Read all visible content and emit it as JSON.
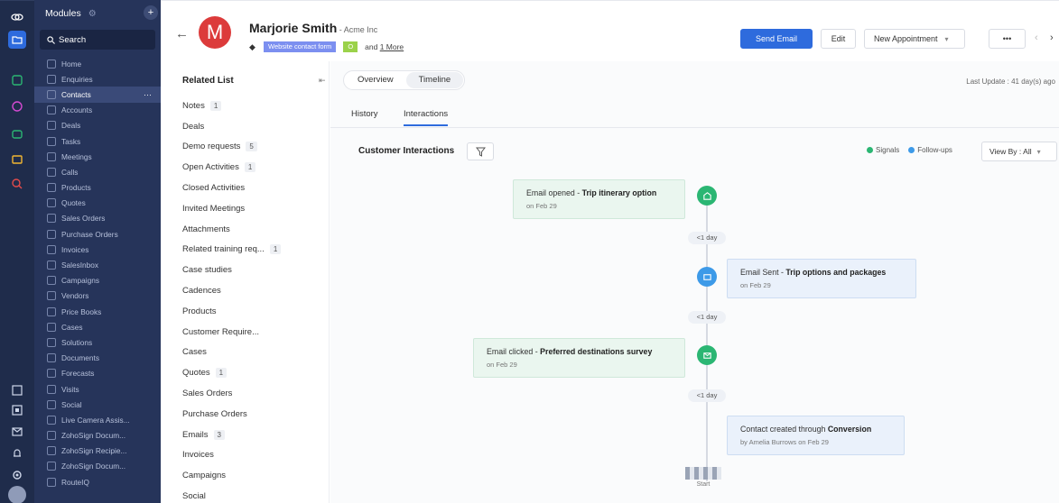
{
  "rail": {
    "icons": [
      "logo-icon",
      "folder-icon",
      "home-app-icon",
      "analytics-icon",
      "chat-icon",
      "bag-icon",
      "search-rail-icon",
      "import-icon",
      "dashboard-icon",
      "mail-icon",
      "bell-icon",
      "settings-icon",
      "avatar-icon"
    ]
  },
  "sidebar": {
    "title": "Modules",
    "search_label": "Search",
    "items": [
      {
        "label": "Home"
      },
      {
        "label": "Enquiries"
      },
      {
        "label": "Contacts",
        "active": true
      },
      {
        "label": "Accounts"
      },
      {
        "label": "Deals"
      },
      {
        "label": "Tasks"
      },
      {
        "label": "Meetings"
      },
      {
        "label": "Calls"
      },
      {
        "label": "Products"
      },
      {
        "label": "Quotes"
      },
      {
        "label": "Sales Orders"
      },
      {
        "label": "Purchase Orders"
      },
      {
        "label": "Invoices"
      },
      {
        "label": "SalesInbox"
      },
      {
        "label": "Campaigns"
      },
      {
        "label": "Vendors"
      },
      {
        "label": "Price Books"
      },
      {
        "label": "Cases"
      },
      {
        "label": "Solutions"
      },
      {
        "label": "Documents"
      },
      {
        "label": "Forecasts"
      },
      {
        "label": "Visits"
      },
      {
        "label": "Social"
      },
      {
        "label": "Live Camera Assis..."
      },
      {
        "label": "ZohoSign Docum..."
      },
      {
        "label": "ZohoSign Recipie..."
      },
      {
        "label": "ZohoSign Docum..."
      },
      {
        "label": "RouteIQ"
      }
    ]
  },
  "header": {
    "avatar_letter": "M",
    "name": "Marjorie Smith",
    "company": " - Acme Inc",
    "tag_source": "Website contact form",
    "tag_short": "O",
    "and_prefix": "and ",
    "and_more": "1 More",
    "send_email": "Send Email",
    "edit": "Edit",
    "new_appointment": "New Appointment",
    "more": "•••"
  },
  "related": {
    "title": "Related List",
    "items": [
      {
        "label": "Notes",
        "count": "1"
      },
      {
        "label": "Deals"
      },
      {
        "label": "Demo requests",
        "count": "5"
      },
      {
        "label": "Open Activities",
        "count": "1"
      },
      {
        "label": "Closed Activities"
      },
      {
        "label": "Invited Meetings"
      },
      {
        "label": "Attachments"
      },
      {
        "label": "Related training req...",
        "count": "1"
      },
      {
        "label": "Case studies"
      },
      {
        "label": "Cadences"
      },
      {
        "label": "Products"
      },
      {
        "label": "Customer Require..."
      },
      {
        "label": "Cases"
      },
      {
        "label": "Quotes",
        "count": "1"
      },
      {
        "label": "Sales Orders"
      },
      {
        "label": "Purchase Orders"
      },
      {
        "label": "Emails",
        "count": "3"
      },
      {
        "label": "Invoices"
      },
      {
        "label": "Campaigns"
      },
      {
        "label": "Social"
      }
    ]
  },
  "main": {
    "tabs": [
      "Overview",
      "Timeline"
    ],
    "active_tab": "Timeline",
    "last_update": "Last Update : 41 day(s) ago",
    "subtabs": [
      "History",
      "Interactions"
    ],
    "section_title": "Customer Interactions",
    "legend": [
      {
        "label": "Signals",
        "color": "#2bb673"
      },
      {
        "label": "Follow-ups",
        "color": "#3d9ae8"
      }
    ],
    "view_by": "View By : All",
    "timeline": [
      {
        "prefix": "Email opened - ",
        "bold": "Trip itinerary option",
        "date": "on Feb 29",
        "kind": "green"
      },
      {
        "gap": "<1 day"
      },
      {
        "prefix": "Email Sent - ",
        "bold": "Trip options and packages",
        "date": "on Feb 29",
        "kind": "blue"
      },
      {
        "gap": "<1 day"
      },
      {
        "prefix": "Email clicked - ",
        "bold": "Preferred destinations survey",
        "date": "on Feb 29",
        "kind": "green"
      },
      {
        "gap": "<1 day"
      },
      {
        "prefix": "Contact created through ",
        "bold": "Conversion",
        "date": "by Amelia Burrows on Feb 29",
        "kind": "blue"
      }
    ],
    "start_label": "Start"
  }
}
